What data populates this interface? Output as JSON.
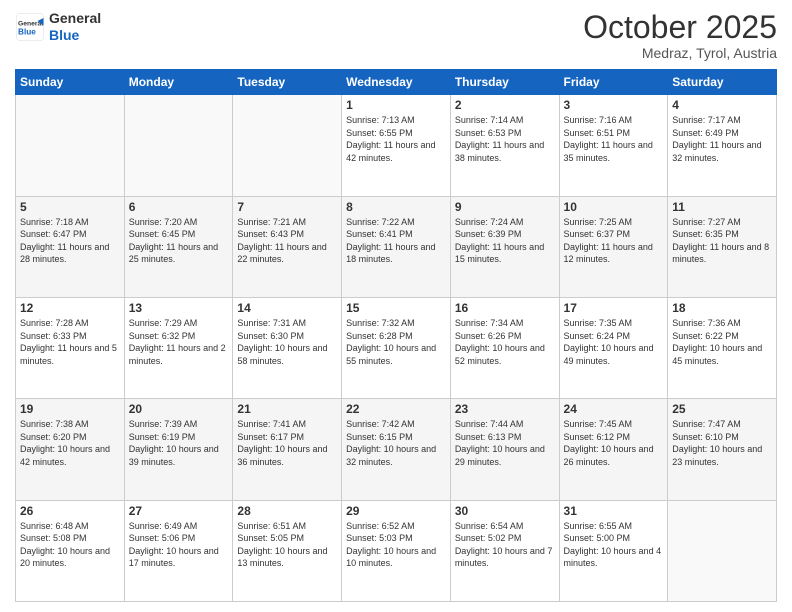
{
  "header": {
    "logo_general": "General",
    "logo_blue": "Blue",
    "month_title": "October 2025",
    "location": "Medraz, Tyrol, Austria"
  },
  "days_of_week": [
    "Sunday",
    "Monday",
    "Tuesday",
    "Wednesday",
    "Thursday",
    "Friday",
    "Saturday"
  ],
  "weeks": [
    [
      {
        "day": "",
        "info": ""
      },
      {
        "day": "",
        "info": ""
      },
      {
        "day": "",
        "info": ""
      },
      {
        "day": "1",
        "info": "Sunrise: 7:13 AM\nSunset: 6:55 PM\nDaylight: 11 hours and 42 minutes."
      },
      {
        "day": "2",
        "info": "Sunrise: 7:14 AM\nSunset: 6:53 PM\nDaylight: 11 hours and 38 minutes."
      },
      {
        "day": "3",
        "info": "Sunrise: 7:16 AM\nSunset: 6:51 PM\nDaylight: 11 hours and 35 minutes."
      },
      {
        "day": "4",
        "info": "Sunrise: 7:17 AM\nSunset: 6:49 PM\nDaylight: 11 hours and 32 minutes."
      }
    ],
    [
      {
        "day": "5",
        "info": "Sunrise: 7:18 AM\nSunset: 6:47 PM\nDaylight: 11 hours and 28 minutes."
      },
      {
        "day": "6",
        "info": "Sunrise: 7:20 AM\nSunset: 6:45 PM\nDaylight: 11 hours and 25 minutes."
      },
      {
        "day": "7",
        "info": "Sunrise: 7:21 AM\nSunset: 6:43 PM\nDaylight: 11 hours and 22 minutes."
      },
      {
        "day": "8",
        "info": "Sunrise: 7:22 AM\nSunset: 6:41 PM\nDaylight: 11 hours and 18 minutes."
      },
      {
        "day": "9",
        "info": "Sunrise: 7:24 AM\nSunset: 6:39 PM\nDaylight: 11 hours and 15 minutes."
      },
      {
        "day": "10",
        "info": "Sunrise: 7:25 AM\nSunset: 6:37 PM\nDaylight: 11 hours and 12 minutes."
      },
      {
        "day": "11",
        "info": "Sunrise: 7:27 AM\nSunset: 6:35 PM\nDaylight: 11 hours and 8 minutes."
      }
    ],
    [
      {
        "day": "12",
        "info": "Sunrise: 7:28 AM\nSunset: 6:33 PM\nDaylight: 11 hours and 5 minutes."
      },
      {
        "day": "13",
        "info": "Sunrise: 7:29 AM\nSunset: 6:32 PM\nDaylight: 11 hours and 2 minutes."
      },
      {
        "day": "14",
        "info": "Sunrise: 7:31 AM\nSunset: 6:30 PM\nDaylight: 10 hours and 58 minutes."
      },
      {
        "day": "15",
        "info": "Sunrise: 7:32 AM\nSunset: 6:28 PM\nDaylight: 10 hours and 55 minutes."
      },
      {
        "day": "16",
        "info": "Sunrise: 7:34 AM\nSunset: 6:26 PM\nDaylight: 10 hours and 52 minutes."
      },
      {
        "day": "17",
        "info": "Sunrise: 7:35 AM\nSunset: 6:24 PM\nDaylight: 10 hours and 49 minutes."
      },
      {
        "day": "18",
        "info": "Sunrise: 7:36 AM\nSunset: 6:22 PM\nDaylight: 10 hours and 45 minutes."
      }
    ],
    [
      {
        "day": "19",
        "info": "Sunrise: 7:38 AM\nSunset: 6:20 PM\nDaylight: 10 hours and 42 minutes."
      },
      {
        "day": "20",
        "info": "Sunrise: 7:39 AM\nSunset: 6:19 PM\nDaylight: 10 hours and 39 minutes."
      },
      {
        "day": "21",
        "info": "Sunrise: 7:41 AM\nSunset: 6:17 PM\nDaylight: 10 hours and 36 minutes."
      },
      {
        "day": "22",
        "info": "Sunrise: 7:42 AM\nSunset: 6:15 PM\nDaylight: 10 hours and 32 minutes."
      },
      {
        "day": "23",
        "info": "Sunrise: 7:44 AM\nSunset: 6:13 PM\nDaylight: 10 hours and 29 minutes."
      },
      {
        "day": "24",
        "info": "Sunrise: 7:45 AM\nSunset: 6:12 PM\nDaylight: 10 hours and 26 minutes."
      },
      {
        "day": "25",
        "info": "Sunrise: 7:47 AM\nSunset: 6:10 PM\nDaylight: 10 hours and 23 minutes."
      }
    ],
    [
      {
        "day": "26",
        "info": "Sunrise: 6:48 AM\nSunset: 5:08 PM\nDaylight: 10 hours and 20 minutes."
      },
      {
        "day": "27",
        "info": "Sunrise: 6:49 AM\nSunset: 5:06 PM\nDaylight: 10 hours and 17 minutes."
      },
      {
        "day": "28",
        "info": "Sunrise: 6:51 AM\nSunset: 5:05 PM\nDaylight: 10 hours and 13 minutes."
      },
      {
        "day": "29",
        "info": "Sunrise: 6:52 AM\nSunset: 5:03 PM\nDaylight: 10 hours and 10 minutes."
      },
      {
        "day": "30",
        "info": "Sunrise: 6:54 AM\nSunset: 5:02 PM\nDaylight: 10 hours and 7 minutes."
      },
      {
        "day": "31",
        "info": "Sunrise: 6:55 AM\nSunset: 5:00 PM\nDaylight: 10 hours and 4 minutes."
      },
      {
        "day": "",
        "info": ""
      }
    ]
  ]
}
